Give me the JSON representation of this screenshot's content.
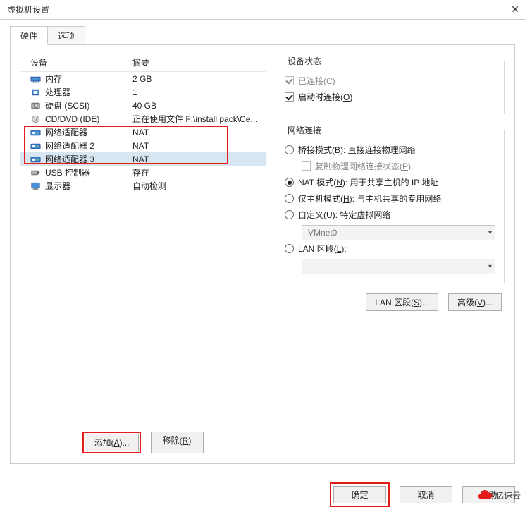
{
  "window": {
    "title": "虚拟机设置"
  },
  "tabs": {
    "hardware": "硬件",
    "options": "选项"
  },
  "table": {
    "device_header": "设备",
    "summary_header": "摘要"
  },
  "devices": [
    {
      "icon": "memory-icon",
      "name": "内存",
      "summary": "2 GB"
    },
    {
      "icon": "cpu-icon",
      "name": "处理器",
      "summary": "1"
    },
    {
      "icon": "disk-icon",
      "name": "硬盘 (SCSI)",
      "summary": "40 GB"
    },
    {
      "icon": "cd-icon",
      "name": "CD/DVD (IDE)",
      "summary": "正在使用文件 F:\\install pack\\Ce..."
    },
    {
      "icon": "network-icon",
      "name": "网络适配器",
      "summary": "NAT"
    },
    {
      "icon": "network-icon",
      "name": "网络适配器 2",
      "summary": "NAT"
    },
    {
      "icon": "network-icon",
      "name": "网络适配器 3",
      "summary": "NAT"
    },
    {
      "icon": "usb-icon",
      "name": "USB 控制器",
      "summary": "存在"
    },
    {
      "icon": "display-icon",
      "name": "显示器",
      "summary": "自动检测"
    }
  ],
  "left_buttons": {
    "add": "添加(",
    "add_m": "A",
    "add_tail": ")...",
    "remove": "移除(",
    "remove_m": "R",
    "remove_tail": ")"
  },
  "status_group": {
    "legend": "设备状态",
    "connected": "已连接(",
    "connected_m": "C",
    "connected_tail": ")",
    "connect_on": "启动时连接(",
    "connect_on_m": "O",
    "connect_on_tail": ")"
  },
  "net_group": {
    "legend": "网络连接",
    "bridged": "桥接模式(",
    "bridged_m": "B",
    "bridged_tail": "): 直接连接物理网络",
    "replicate": "复制物理网络连接状态(",
    "replicate_m": "P",
    "replicate_tail": ")",
    "nat": "NAT 模式(",
    "nat_m": "N",
    "nat_tail": "): 用于共享主机的 IP 地址",
    "hostonly": "仅主机模式(",
    "hostonly_m": "H",
    "hostonly_tail": "): 与主机共享的专用网络",
    "custom": "自定义(",
    "custom_m": "U",
    "custom_tail": "): 特定虚拟网络",
    "vmnet": "VMnet0",
    "lan": "LAN 区段(",
    "lan_m": "L",
    "lan_tail": "):"
  },
  "right_buttons": {
    "lanseg": "LAN 区段(",
    "lanseg_m": "S",
    "lanseg_tail": ")...",
    "advanced": "高级(",
    "advanced_m": "V",
    "advanced_tail": ")..."
  },
  "footer": {
    "ok": "确定",
    "cancel": "取消",
    "help": "帮助"
  },
  "watermark": "亿速云"
}
